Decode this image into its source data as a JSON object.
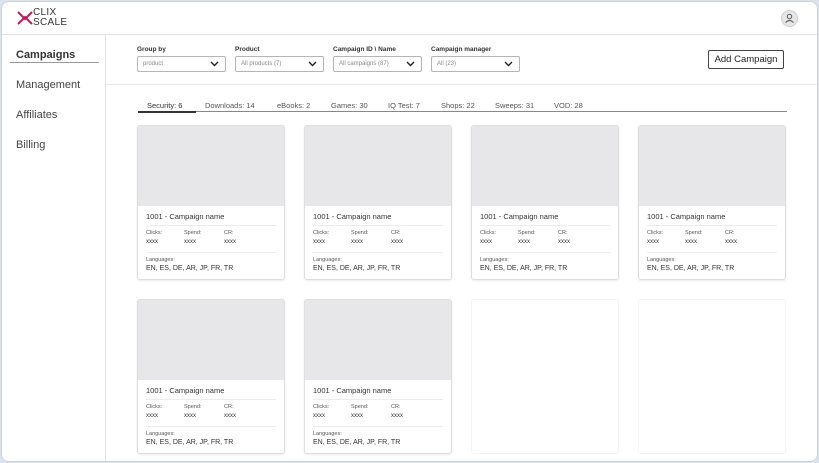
{
  "brand": {
    "line1": "CLIX",
    "line2": "SCALE",
    "accent": "#c2185b"
  },
  "user": {
    "icon": "user-icon"
  },
  "sidebar": {
    "items": [
      {
        "label": "Campaigns",
        "active": true
      },
      {
        "label": "Management"
      },
      {
        "label": "Affiliates"
      },
      {
        "label": "Billing"
      }
    ]
  },
  "filters": [
    {
      "label": "Group by",
      "value": "product"
    },
    {
      "label": "Product",
      "value": "All products (7)"
    },
    {
      "label": "Campaign ID \\ Name",
      "value": "All campaigns (87)"
    },
    {
      "label": "Campaign manager",
      "value": "All (23)"
    }
  ],
  "actions": {
    "add_campaign": "Add Campaign"
  },
  "tabs": [
    {
      "label": "Security: 6",
      "active": true
    },
    {
      "label": "Downloads: 14"
    },
    {
      "label": "eBooks: 2"
    },
    {
      "label": "Games: 30"
    },
    {
      "label": "IQ Test: 7"
    },
    {
      "label": "Shops: 22"
    },
    {
      "label": "Sweeps: 31"
    },
    {
      "label": "VOD: 28"
    }
  ],
  "card_labels": {
    "clicks": "Clicks:",
    "spend": "Spend:",
    "cr": "CR:",
    "languages": "Languages:"
  },
  "cards": [
    {
      "title": "1001 - Campaign name",
      "clicks": "xxxx",
      "spend": "xxxx",
      "cr": "xxxx",
      "languages": "EN, ES, DE, AR, JP, FR, TR"
    },
    {
      "title": "1001 - Campaign name",
      "clicks": "xxxx",
      "spend": "xxxx",
      "cr": "xxxx",
      "languages": "EN, ES, DE, AR, JP, FR, TR"
    },
    {
      "title": "1001 - Campaign name",
      "clicks": "xxxx",
      "spend": "xxxx",
      "cr": "xxxx",
      "languages": "EN, ES, DE, AR, JP, FR, TR"
    },
    {
      "title": "1001 - Campaign name",
      "clicks": "xxxx",
      "spend": "xxxx",
      "cr": "xxxx",
      "languages": "EN, ES, DE, AR, JP, FR, TR"
    },
    {
      "title": "1001 - Campaign name",
      "clicks": "xxxx",
      "spend": "xxxx",
      "cr": "xxxx",
      "languages": "EN, ES, DE, AR, JP, FR, TR"
    },
    {
      "title": "1001 - Campaign name",
      "clicks": "xxxx",
      "spend": "xxxx",
      "cr": "xxxx",
      "languages": "EN, ES, DE, AR, JP, FR, TR"
    }
  ]
}
